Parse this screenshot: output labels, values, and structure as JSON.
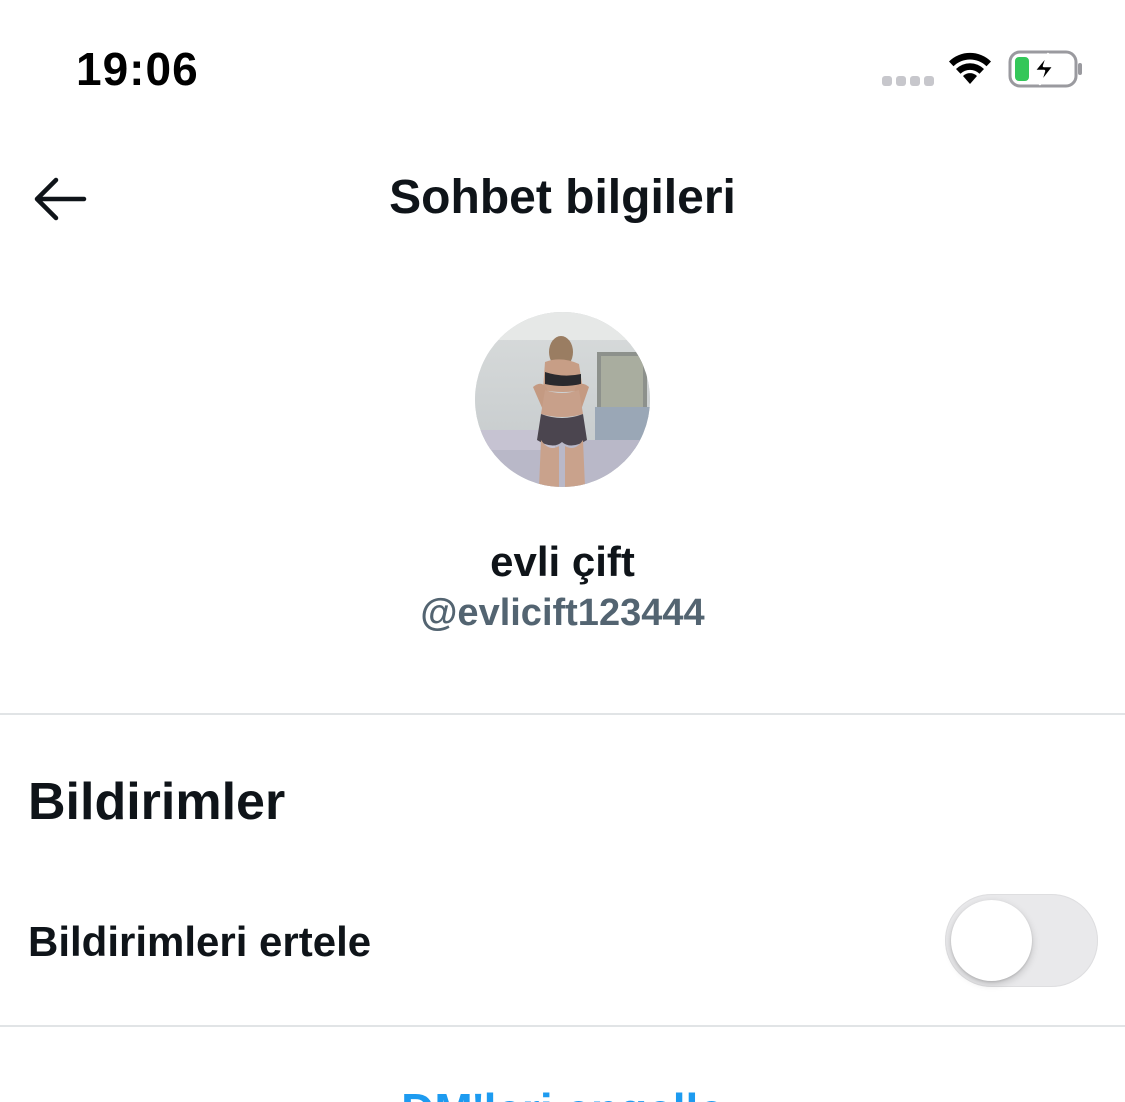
{
  "status_bar": {
    "time": "19:06",
    "signal_icon": "signal-dots-icon",
    "wifi_icon": "wifi-icon",
    "battery_icon": "battery-charging-icon",
    "battery_level": 0.25,
    "battery_color": "#34c759"
  },
  "header": {
    "title": "Sohbet bilgileri",
    "back_icon": "arrow-left-icon"
  },
  "profile": {
    "display_name": "evli çift",
    "username": "@evlicift123444"
  },
  "notifications": {
    "section_title": "Bildirimler",
    "snooze_label": "Bildirimleri ertele",
    "snooze_enabled": false
  },
  "actions": {
    "block_dms_label": "DM'leri engelle",
    "block_dms_color": "#1d9bf0"
  }
}
